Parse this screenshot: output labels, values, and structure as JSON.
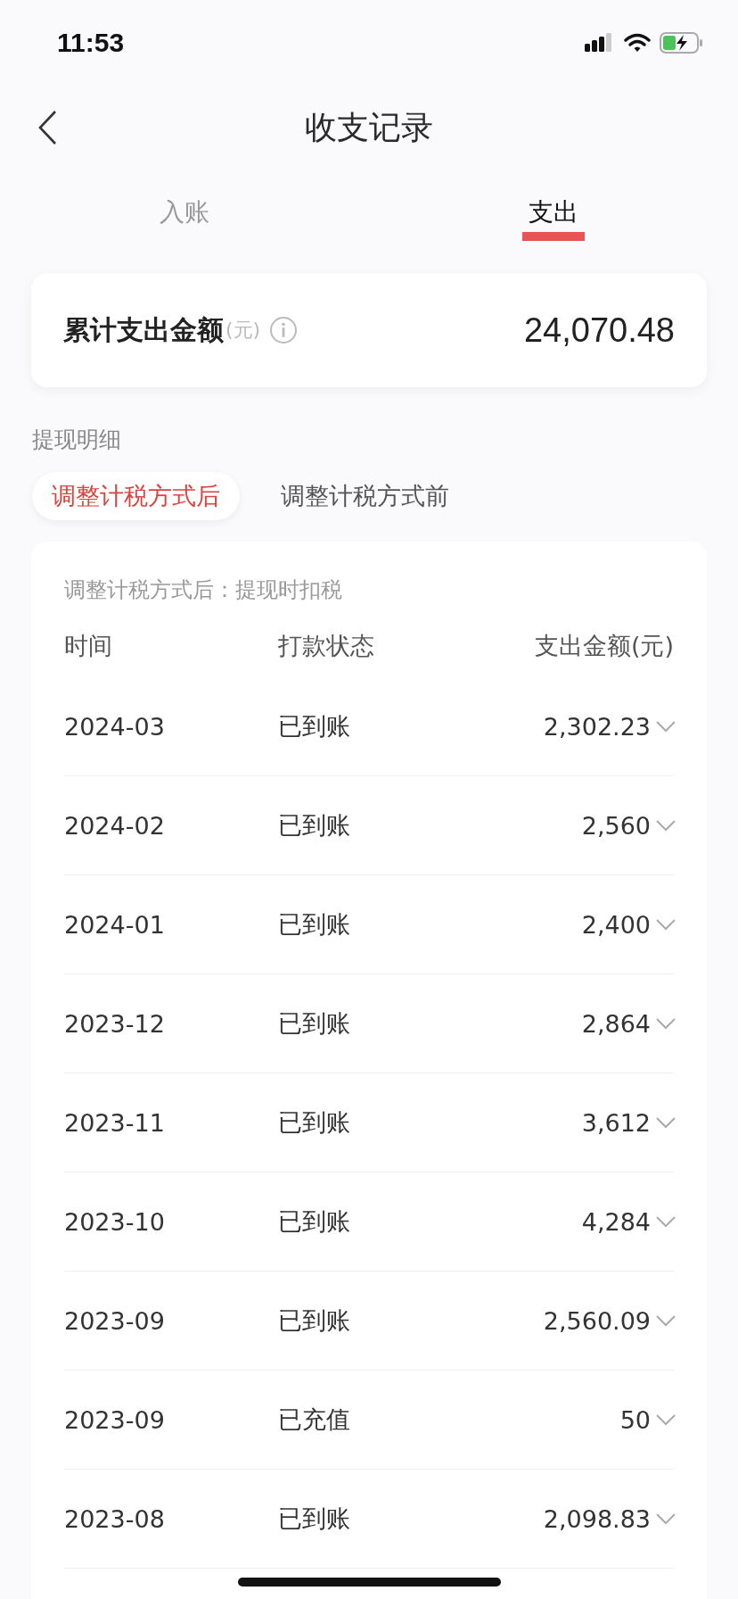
{
  "status_bar": {
    "time": "11:53"
  },
  "header": {
    "title": "收支记录"
  },
  "tabs": [
    {
      "label": "入账",
      "selected": false
    },
    {
      "label": "支出",
      "selected": true
    }
  ],
  "summary": {
    "label": "累计支出金额",
    "unit": "(元)",
    "amount": "24,070.48"
  },
  "section_title": "提现明细",
  "segments": [
    {
      "label": "调整计税方式后",
      "selected": true
    },
    {
      "label": "调整计税方式前",
      "selected": false
    }
  ],
  "note": "调整计税方式后：提现时扣税",
  "table": {
    "columns": [
      "时间",
      "打款状态",
      "支出金额(元)"
    ],
    "rows": [
      {
        "time": "2024-03",
        "status": "已到账",
        "amount": "2,302.23",
        "expanded": false
      },
      {
        "time": "2024-02",
        "status": "已到账",
        "amount": "2,560",
        "expanded": false
      },
      {
        "time": "2024-01",
        "status": "已到账",
        "amount": "2,400",
        "expanded": false
      },
      {
        "time": "2023-12",
        "status": "已到账",
        "amount": "2,864",
        "expanded": false
      },
      {
        "time": "2023-11",
        "status": "已到账",
        "amount": "3,612",
        "expanded": false
      },
      {
        "time": "2023-10",
        "status": "已到账",
        "amount": "4,284",
        "expanded": false
      },
      {
        "time": "2023-09",
        "status": "已到账",
        "amount": "2,560.09",
        "expanded": false
      },
      {
        "time": "2023-09",
        "status": "已充值",
        "amount": "50",
        "expanded": false
      },
      {
        "time": "2023-08",
        "status": "已到账",
        "amount": "2,098.83",
        "expanded": false
      }
    ]
  }
}
